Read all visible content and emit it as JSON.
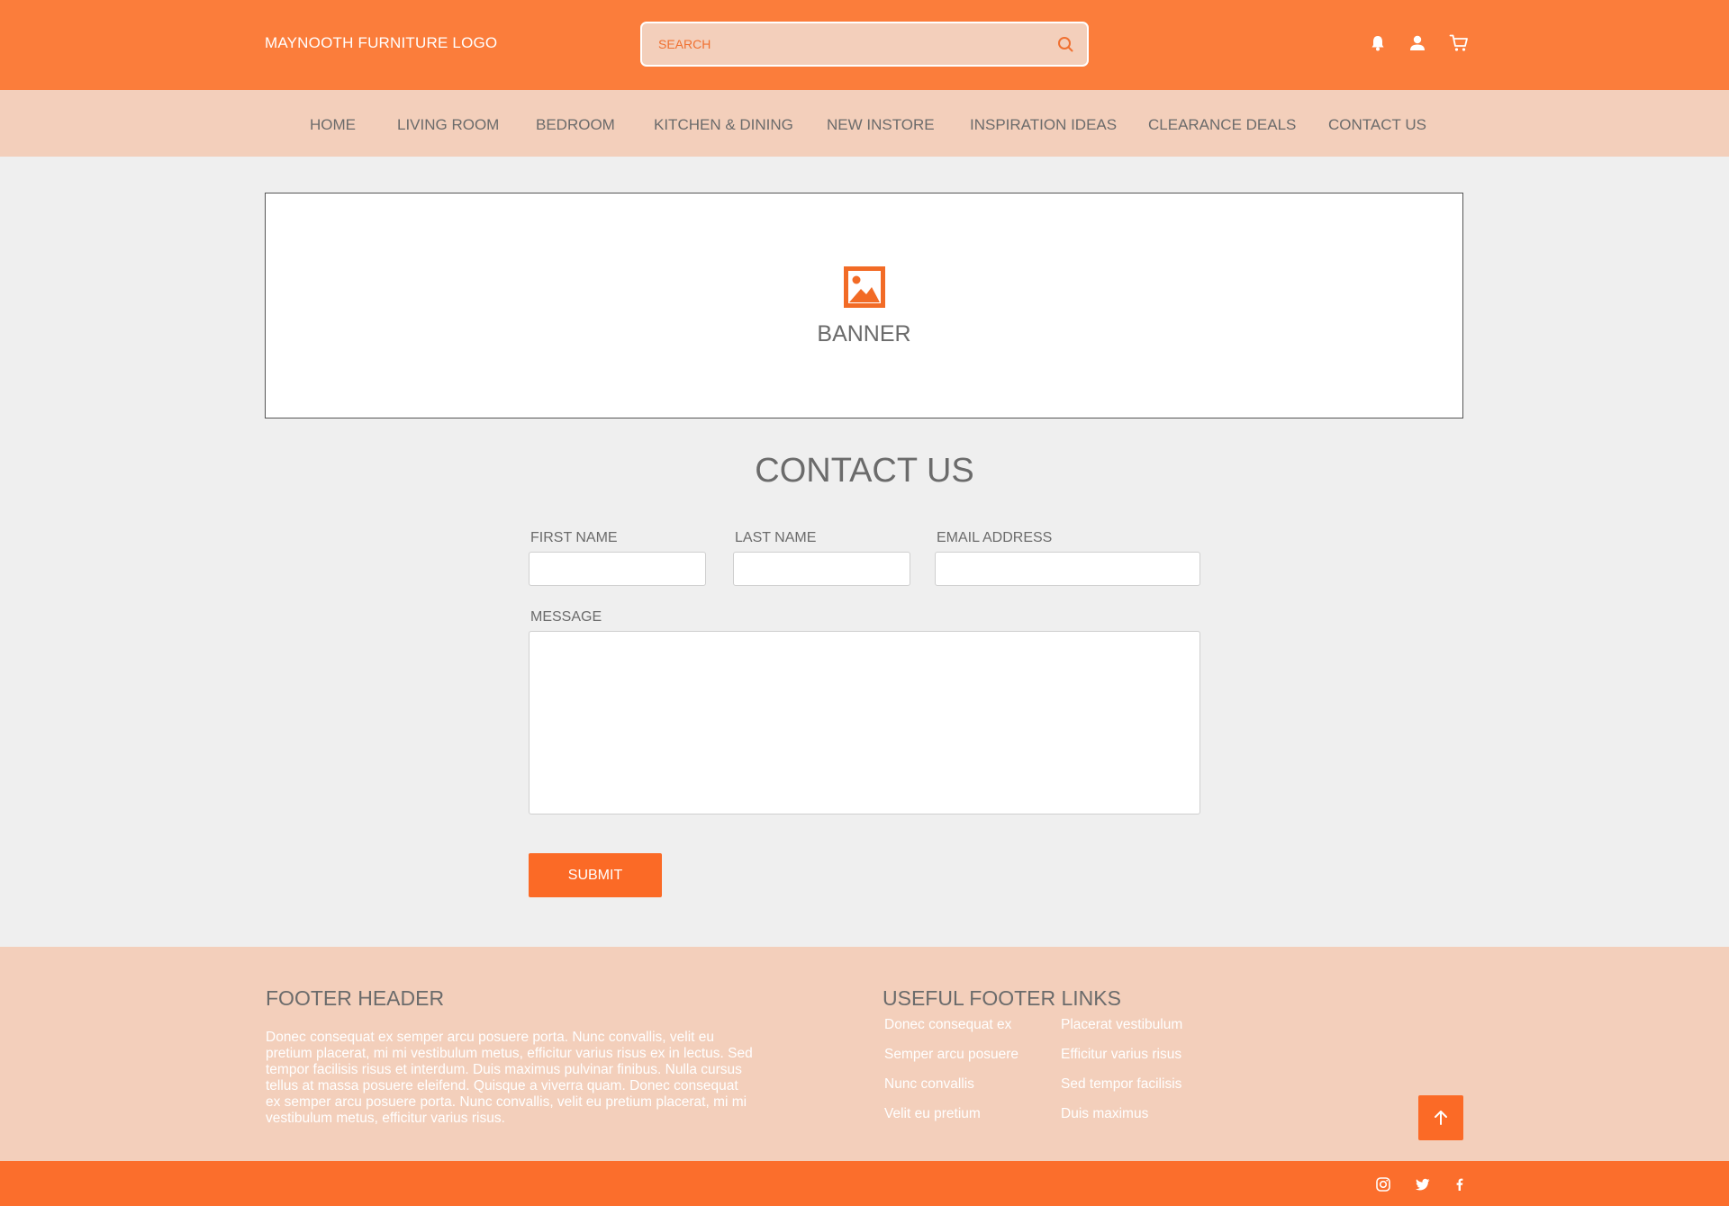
{
  "header": {
    "logo": "MAYNOOTH FURNITURE LOGO",
    "search_placeholder": "SEARCH",
    "icons": [
      "bell-icon",
      "user-icon",
      "cart-icon"
    ]
  },
  "nav": {
    "items": [
      "HOME",
      "LIVING ROOM",
      "BEDROOM",
      "KITCHEN & DINING",
      "NEW INSTORE",
      "INSPIRATION IDEAS",
      "CLEARANCE DEALS",
      "CONTACT US"
    ]
  },
  "banner": {
    "label": "BANNER",
    "icon": "image-icon"
  },
  "contact": {
    "title": "CONTACT US",
    "first_name_label": "FIRST NAME",
    "last_name_label": "LAST NAME",
    "email_label": "EMAIL ADDRESS",
    "message_label": "MESSAGE",
    "submit_label": "SUBMIT"
  },
  "footer": {
    "header": "FOOTER HEADER",
    "text": "Donec consequat ex semper arcu posuere porta. Nunc convallis, velit eu pretium placerat, mi mi vestibulum metus, efficitur varius risus ex in lectus. Sed tempor facilisis risus et interdum. Duis maximus pulvinar finibus. Nulla cursus tellus at massa posuere eleifend. Quisque a viverra quam. Donec consequat ex semper arcu posuere porta. Nunc convallis, velit eu pretium placerat, mi mi vestibulum metus, efficitur varius risus.",
    "links_header": "USEFUL FOOTER LINKS",
    "links": [
      "Donec consequat ex",
      "Placerat vestibulum",
      "Semper arcu posuere",
      "Efficitur varius risus",
      "Nunc convallis",
      "Sed tempor facilisis",
      "Velit eu pretium",
      "Duis maximus"
    ],
    "social_icons": [
      "instagram-icon",
      "twitter-icon",
      "facebook-icon"
    ]
  },
  "colors": {
    "brand_orange": "#fb7d3b",
    "accent_orange": "#fb6a26",
    "peach": "#f3cfbb",
    "page_bg": "#efefef"
  }
}
